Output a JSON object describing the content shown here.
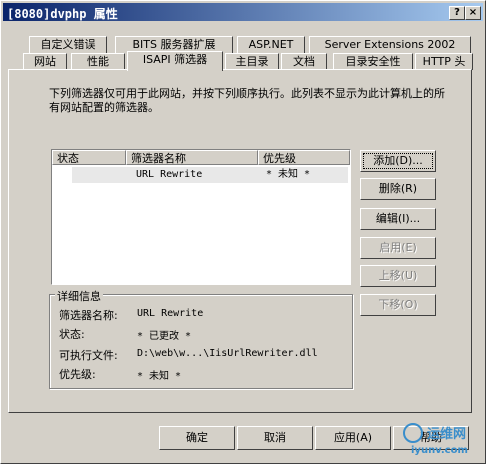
{
  "window": {
    "title": "[8080]dvphp 属性",
    "help_glyph": "?",
    "close_glyph": "×"
  },
  "tabs": {
    "row1": [
      "自定义错误",
      "BITS 服务器扩展",
      "ASP.NET",
      "Server Extensions 2002"
    ],
    "row2": [
      "网站",
      "性能",
      "ISAPI 筛选器",
      "主目录",
      "文档",
      "目录安全性",
      "HTTP 头"
    ],
    "active": "ISAPI 筛选器"
  },
  "description": "下列筛选器仅可用于此网站，并按下列顺序执行。此列表不显示为此计算机上的所有网站配置的筛选器。",
  "filter_list": {
    "columns": [
      "状态",
      "筛选器名称",
      "优先级"
    ],
    "rows": [
      {
        "status": "",
        "name": "URL Rewrite",
        "priority": "* 未知 *"
      }
    ]
  },
  "side_buttons": {
    "add": "添加(D)...",
    "remove": "删除(R)",
    "edit": "编辑(I)...",
    "enable": "启用(E)",
    "move_up": "上移(U)",
    "move_down": "下移(O)"
  },
  "details": {
    "title": "详细信息",
    "name_label": "筛选器名称:",
    "name_value": "URL Rewrite",
    "status_label": "状态:",
    "status_value": "* 已更改 *",
    "exe_label": "可执行文件:",
    "exe_value": "D:\\web\\w...\\IisUrlRewriter.dll",
    "priority_label": "优先级:",
    "priority_value": "* 未知 *"
  },
  "footer": {
    "ok": "确定",
    "cancel": "取消",
    "apply": "应用(A)",
    "help": "帮助"
  },
  "watermark": {
    "line1": "运维网",
    "line2": "iyunv.com"
  }
}
